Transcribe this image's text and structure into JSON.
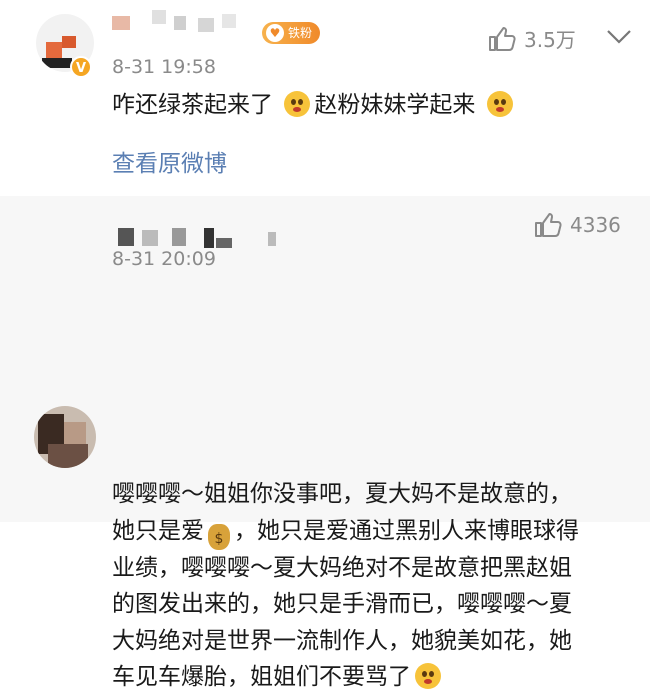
{
  "comments": [
    {
      "time": "8-31 19:58",
      "likes": "3.5万",
      "fan_badge": "铁粉",
      "text_a": "咋还绿茶起来了",
      "text_b": "赵粉妹妹学起来",
      "view_original": "查看原微博"
    },
    {
      "time": "8-31 20:09",
      "likes": "4336",
      "lines": [
        "嘤嘤嘤～姐姐你没事吧，夏大妈不是故意的，",
        "她只是爱",
        "，她只是爱通过黑别人来博眼球得",
        "业绩，嘤嘤嘤～夏大妈绝对不是故意把黑赵姐",
        "的图发出来的，她只是手滑而已，嘤嘤嘤～夏",
        "大妈绝对是世界一流制作人，她貌美如花，她",
        "车见车爆胎，姐姐们不要骂了"
      ]
    }
  ],
  "icons": {
    "like": "thumbs-up-icon",
    "menu": "chevron-down-icon",
    "verified": "verified-badge-icon",
    "emoji": "pleading-face-emoji-icon",
    "moneybag": "money-bag-emoji-icon"
  },
  "colors": {
    "link": "#5b7fb3",
    "muted": "#8a8a8a",
    "badge": "#f08a2a"
  }
}
